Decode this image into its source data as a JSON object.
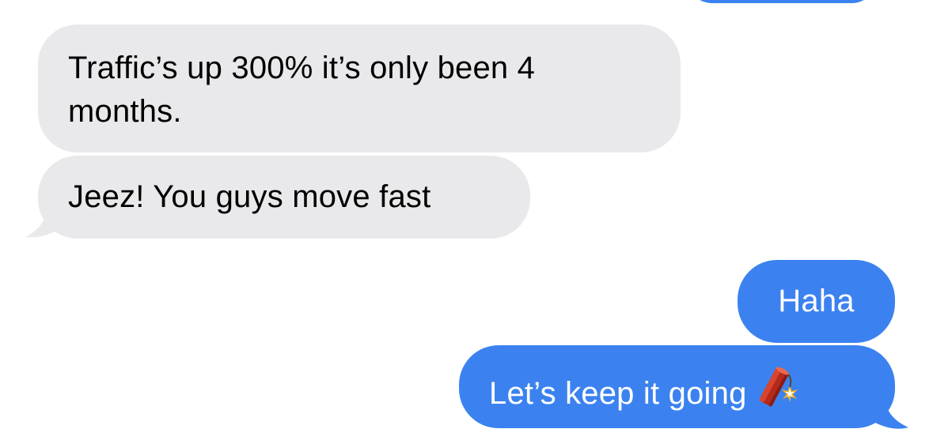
{
  "conversation": {
    "colors": {
      "incoming_bubble": "#e9e9eb",
      "incoming_text": "#000000",
      "outgoing_bubble": "#3b82f0",
      "outgoing_text": "#ffffff",
      "background": "#ffffff"
    },
    "messages": [
      {
        "direction": "incoming",
        "text": "Traffic’s up 300% it’s only been 4 months."
      },
      {
        "direction": "incoming",
        "text": "Jeez! You guys move fast"
      },
      {
        "direction": "outgoing",
        "text": "Haha"
      },
      {
        "direction": "outgoing",
        "text": "Let’s keep it going",
        "emoji": "firecracker-emoji"
      }
    ]
  }
}
